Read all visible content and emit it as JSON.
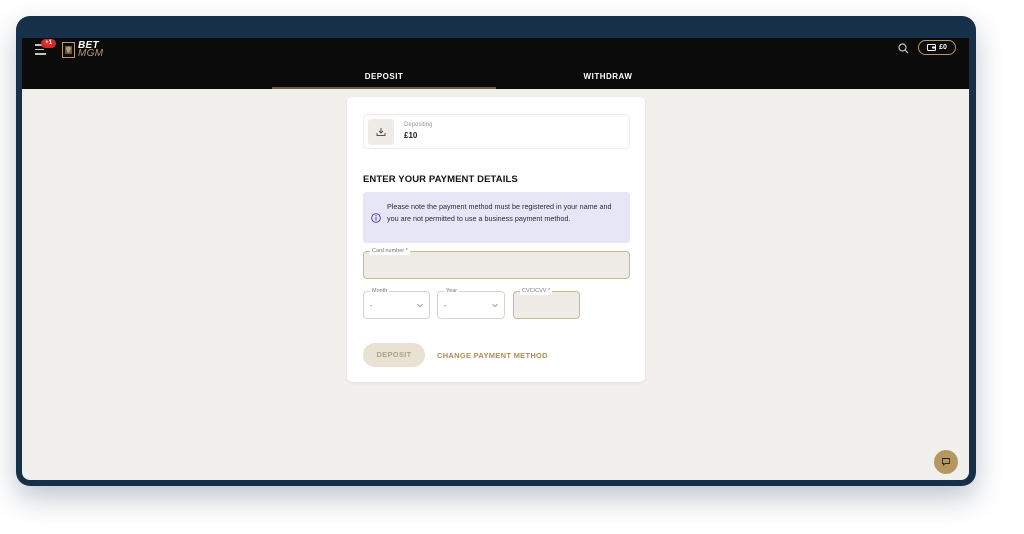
{
  "header": {
    "notification_count": "+1",
    "logo": {
      "line1": "BET",
      "line2": "MGM"
    },
    "wallet_balance": "£0",
    "tabs": [
      {
        "label": "DEPOSIT",
        "active": true
      },
      {
        "label": "WITHDRAW",
        "active": false
      }
    ]
  },
  "deposit_summary": {
    "label": "Depositing",
    "amount": "£10"
  },
  "form": {
    "heading": "ENTER YOUR PAYMENT DETAILS",
    "notice": "Please note the payment method must be registered in your name and you are not permitted to use a business payment method.",
    "card_number_label": "Card number *",
    "month_label": "Month",
    "month_value": "-",
    "year_label": "Year",
    "year_value": "-",
    "cvc_label": "CVC/CVV *",
    "deposit_button": "DEPOSIT",
    "change_method_link": "CHANGE PAYMENT METHOD"
  },
  "colors": {
    "accent_gold": "#b99967",
    "notice_bg": "#e6e6f7",
    "topbar_bg": "#0b0b0b",
    "page_bg": "#f2f0ec",
    "badge_red": "#d62a2a"
  },
  "icons": [
    "menu-icon",
    "search-icon",
    "wallet-icon",
    "download-icon",
    "info-icon",
    "chevron-down-icon",
    "chat-icon"
  ]
}
